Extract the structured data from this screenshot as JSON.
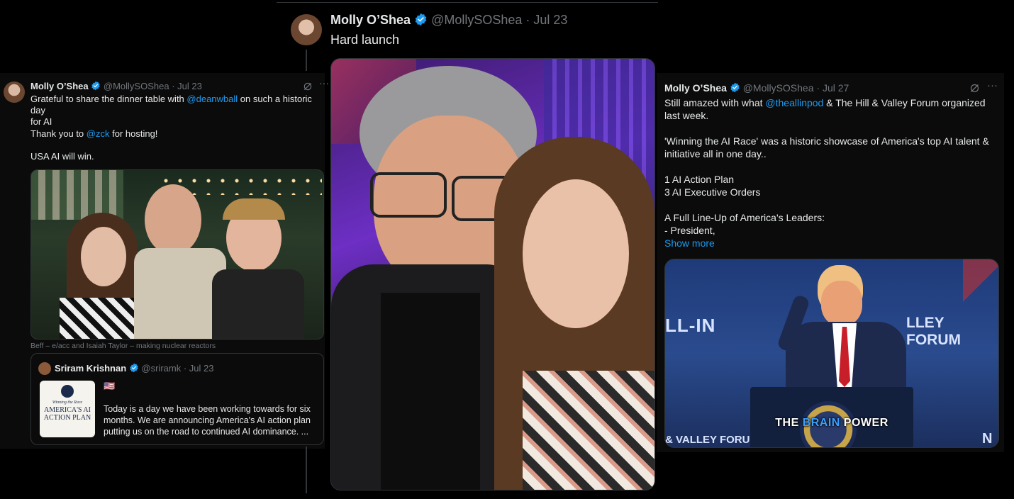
{
  "left_tweet": {
    "author_name": "Molly O’Shea",
    "handle": "@MollySOShea",
    "date": "· Jul 23",
    "text_before_mention": "Grateful to share the dinner table with ",
    "mention1": "@deanwball",
    "text_after_mention": " on such a historic day",
    "line2": "for AI",
    "thanks_before": "Thank you to ",
    "mention2": "@zck",
    "thanks_after": " for hosting!",
    "closing": "USA AI will win.",
    "photo_caption": "Beff – e/acc and Isaiah Taylor – making nuclear reactors",
    "quote": {
      "author_name": "Sriram Krishnan",
      "handle": "@sriramk",
      "date": "· Jul 23",
      "flag": "🇺🇸",
      "text": "Today is a day we have been working towards for six months. We are announcing America's AI action plan putting us on the road to continued AI dominance. ...",
      "thumb_small": "Winning the Race",
      "thumb_title": "AMERICA'S AI ACTION PLAN"
    }
  },
  "center_tweet": {
    "author_name": "Molly O’Shea",
    "handle": "@MollySOShea",
    "date": "· Jul 23",
    "text": "Hard launch"
  },
  "right_tweet": {
    "author_name": "Molly O’Shea",
    "handle": "@MollySOShea",
    "date": "· Jul 27",
    "line1_before": "Still amazed with what ",
    "mention": "@theallinpod",
    "line1_after": " & The Hill & Valley Forum organized",
    "line2": "last week.",
    "para2": "'Winning the AI Race' was a historic showcase of America's top AI talent & initiative all in one day..",
    "item1": "1 AI Action Plan",
    "item2": "3 AI Executive Orders",
    "para4": "A Full Line-Up of America's Leaders:",
    "para5": "- President,",
    "show_more": "Show more",
    "video_sign_left": "LL-IN",
    "video_sign_right": "LLEY FORUM",
    "video_sign_bottom_left": "& VALLEY FORUM",
    "video_sign_bottom_right": "N",
    "caption_pre": "THE ",
    "caption_highlight": "BRAIN",
    "caption_post": " POWER"
  },
  "colors": {
    "link": "#1d9bf0",
    "verified": "#1d9bf0",
    "muted": "#71767b"
  }
}
